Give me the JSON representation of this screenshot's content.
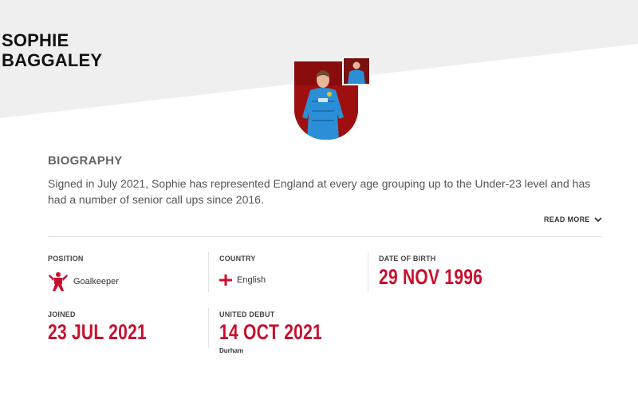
{
  "player": {
    "first_name": "SOPHIE",
    "last_name": "BAGGALEY"
  },
  "biography": {
    "title": "BIOGRAPHY",
    "text": "Signed in July 2021, Sophie has represented England at every age grouping up to the Under-23 level and has had a number of senior call ups since 2016.",
    "read_more_label": "READ MORE"
  },
  "stats": {
    "position": {
      "label": "POSITION",
      "value": "Goalkeeper",
      "icon": "goalkeeper-icon"
    },
    "country": {
      "label": "COUNTRY",
      "value": "English",
      "icon": "england-flag-icon"
    },
    "date_of_birth": {
      "label": "DATE OF BIRTH",
      "value": "29 NOV 1996"
    },
    "joined": {
      "label": "JOINED",
      "value": "23 JUL 2021"
    },
    "united_debut": {
      "label": "UNITED DEBUT",
      "value": "14 OCT 2021",
      "opponent": "Durham"
    }
  },
  "colors": {
    "accent": "#c8102e",
    "kit": "#2a8fd6",
    "photo_background": "#9e1010"
  }
}
